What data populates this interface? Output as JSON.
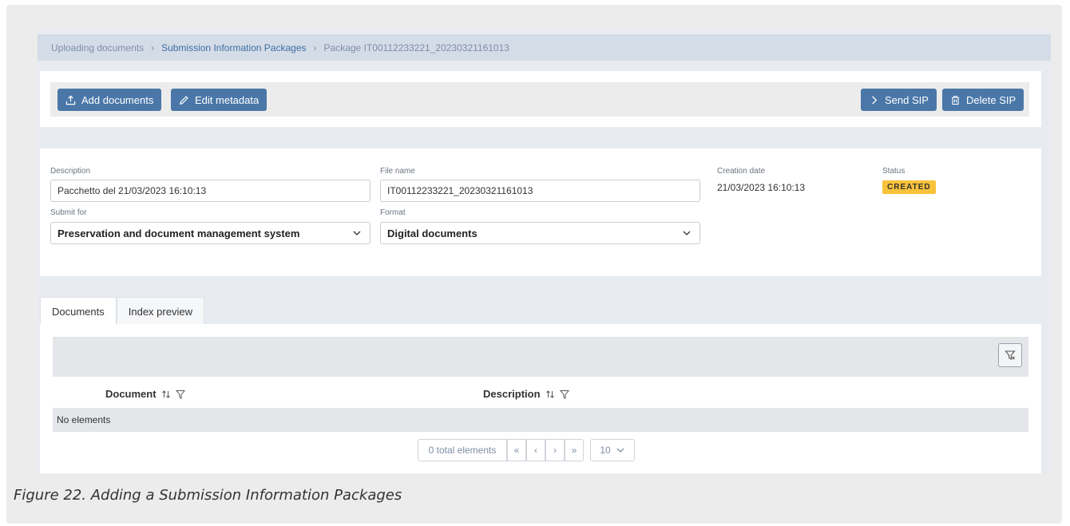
{
  "breadcrumb": {
    "items": [
      "Uploading documents",
      "Submission Information Packages",
      "Package IT00112233221_20230321161013"
    ],
    "separator": "›"
  },
  "toolbar": {
    "add_documents": "Add documents",
    "edit_metadata": "Edit metadata",
    "send_sip": "Send SIP",
    "delete_sip": "Delete SIP"
  },
  "metadata": {
    "description_label": "Description",
    "description_value": "Pacchetto del 21/03/2023 16:10:13",
    "file_name_label": "File name",
    "file_name_value": "IT00112233221_20230321161013",
    "creation_date_label": "Creation date",
    "creation_date_value": "21/03/2023 16:10:13",
    "status_label": "Status",
    "status_value": "CREATED",
    "submit_for_label": "Submit for",
    "submit_for_value": "Preservation and document management system",
    "format_label": "Format",
    "format_value": "Digital documents"
  },
  "tabs": [
    {
      "label": "Documents",
      "active": true
    },
    {
      "label": "Index preview",
      "active": false
    }
  ],
  "table": {
    "columns": [
      {
        "label": "Document",
        "sortable": true,
        "filterable": true
      },
      {
        "label": "Description",
        "sortable": true,
        "filterable": true
      }
    ],
    "empty_text": "No elements"
  },
  "pagination": {
    "total": "0 total elements",
    "first": "«",
    "prev": "‹",
    "next": "›",
    "last": "»",
    "page_size": "10"
  },
  "caption": "Figure 22. Adding a Submission Information Packages",
  "colors": {
    "primary_button": "#4a77a8",
    "status_badge": "#f8c23a",
    "breadcrumb_bg": "#d4dce8"
  }
}
